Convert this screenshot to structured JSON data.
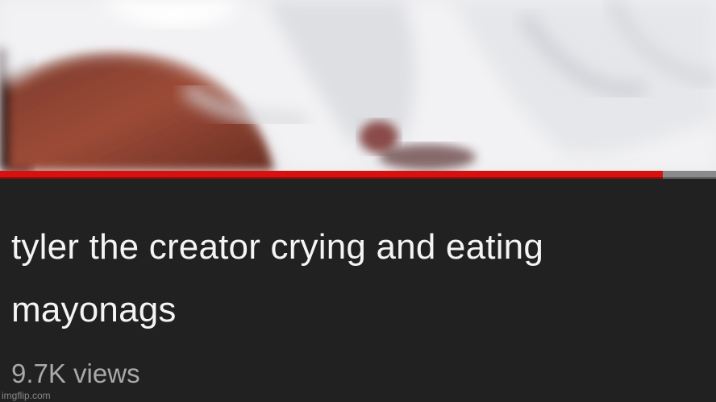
{
  "video": {
    "title": "tyler the creator crying and eating mayonags",
    "views": "9.7K views",
    "progress_percent": 92.6
  },
  "colors": {
    "background": "#212121",
    "progress_played": "#d71010",
    "progress_remaining": "#8a8a8a",
    "title_text": "#f4f4f4",
    "meta_text": "#a9a9a9"
  },
  "watermark": "imgflip.com"
}
